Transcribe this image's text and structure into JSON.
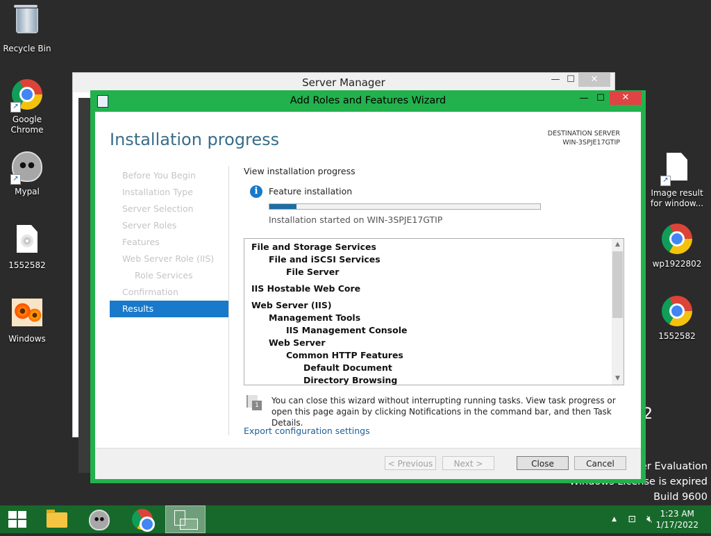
{
  "desktop": {
    "icons": [
      {
        "label": "Recycle Bin"
      },
      {
        "label": "Google Chrome"
      },
      {
        "label": "Mypal"
      },
      {
        "label": "1552582"
      },
      {
        "label": "Windows"
      },
      {
        "label": "Image result for window..."
      },
      {
        "label": "wp1922802"
      },
      {
        "label": "1552582"
      }
    ],
    "watermark": {
      "line1": "ter Evaluation",
      "line2": "Windows License is expired",
      "line3": "Build 9600",
      "fragment": "2"
    }
  },
  "server_manager": {
    "title": "Server Manager",
    "controls": {
      "minimize": "—",
      "maximize": "☐",
      "close": "✕"
    }
  },
  "wizard": {
    "title": "Add Roles and Features Wizard",
    "controls": {
      "minimize": "—",
      "maximize": "☐",
      "close": "✕"
    },
    "heading": "Installation progress",
    "destination_label": "DESTINATION SERVER",
    "destination_server": "WIN-3SPJE17GTIP",
    "nav": [
      {
        "label": "Before You Begin",
        "state": "disabled"
      },
      {
        "label": "Installation Type",
        "state": "disabled"
      },
      {
        "label": "Server Selection",
        "state": "disabled"
      },
      {
        "label": "Server Roles",
        "state": "disabled"
      },
      {
        "label": "Features",
        "state": "disabled"
      },
      {
        "label": "Web Server Role (IIS)",
        "state": "disabled"
      },
      {
        "label": "Role Services",
        "state": "disabled"
      },
      {
        "label": "Confirmation",
        "state": "disabled"
      },
      {
        "label": "Results",
        "state": "active"
      }
    ],
    "view_label": "View installation progress",
    "feature_label": "Feature installation",
    "progress_fraction": 0.1,
    "install_started": "Installation started on WIN-3SPJE17GTIP",
    "results": [
      {
        "text": "File and Storage Services",
        "level": 0
      },
      {
        "text": "File and iSCSI Services",
        "level": 1
      },
      {
        "text": "File Server",
        "level": 2
      },
      {
        "text": "IIS Hostable Web Core",
        "level": 0
      },
      {
        "text": "Web Server (IIS)",
        "level": 0
      },
      {
        "text": "Management Tools",
        "level": 1
      },
      {
        "text": "IIS Management Console",
        "level": 2
      },
      {
        "text": "Web Server",
        "level": 1
      },
      {
        "text": "Common HTTP Features",
        "level": 2
      },
      {
        "text": "Default Document",
        "level": 3
      },
      {
        "text": "Directory Browsing",
        "level": 3
      }
    ],
    "note": "You can close this wizard without interrupting running tasks. View task progress or open this page again by clicking Notifications in the command bar, and then Task Details.",
    "note_badge": "1",
    "export_link": "Export configuration settings",
    "buttons": {
      "previous": "< Previous",
      "next": "Next >",
      "close": "Close",
      "cancel": "Cancel"
    }
  },
  "taskbar": {
    "time": "1:23 AM",
    "date": "1/17/2022",
    "tray_arrow": "▲"
  }
}
